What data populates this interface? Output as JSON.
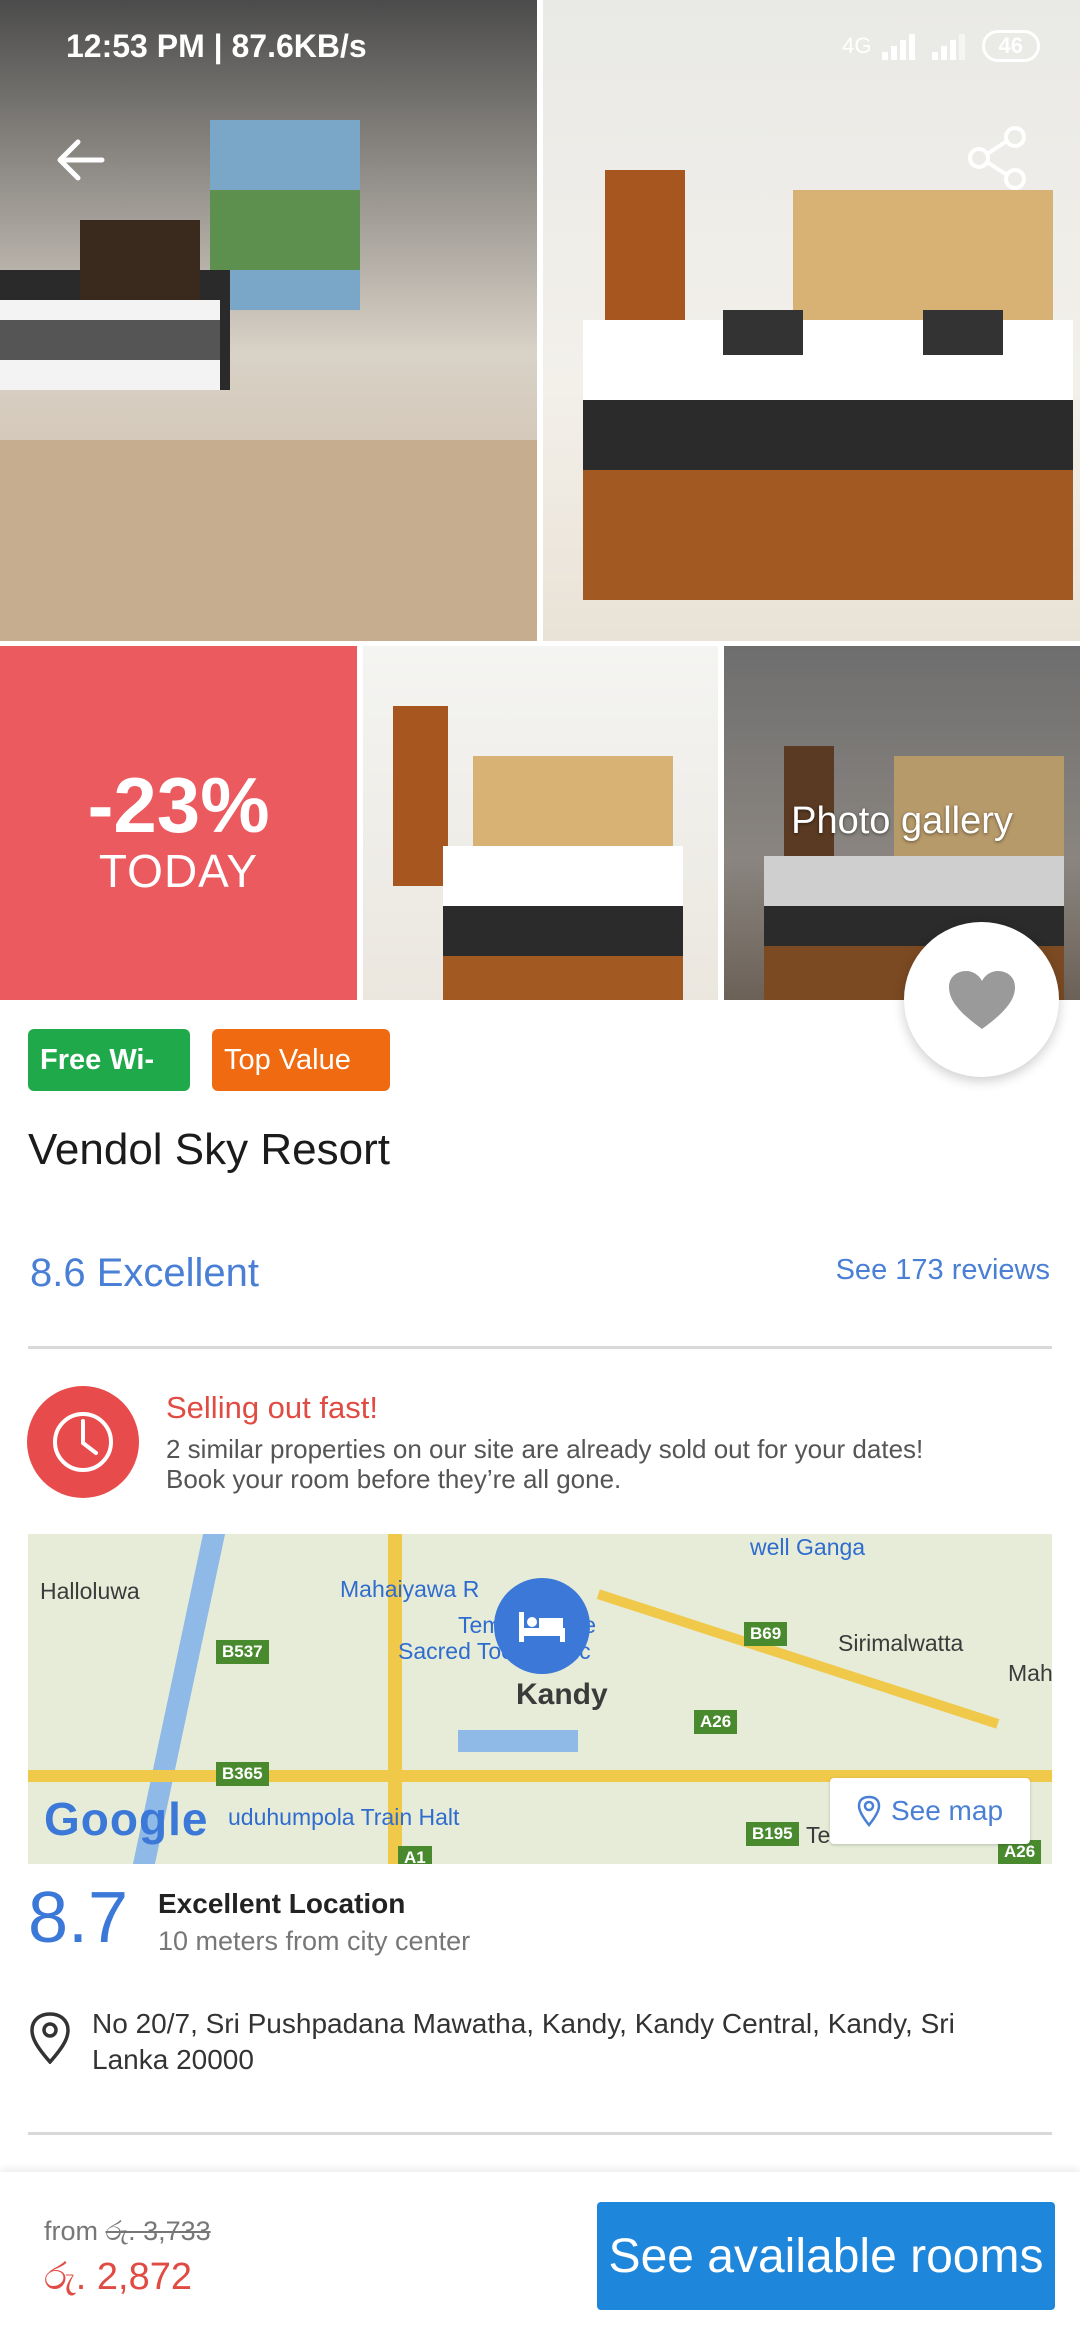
{
  "status_bar": {
    "time": "12:53 PM | 87.6KB/s",
    "network": "4G",
    "battery": "46"
  },
  "gallery": {
    "promo_discount": "-23%",
    "promo_period": "TODAY",
    "label": "Photo gallery"
  },
  "badges": {
    "wifi": "Free Wi-Fi",
    "top_value": "Top Value"
  },
  "hotel": {
    "name": "Vendol Sky Resort",
    "score": "8.6",
    "score_label": "Excellent",
    "reviews_link": "See 173 reviews"
  },
  "urgency": {
    "title": "Selling out fast!",
    "line1": "2 similar properties on our site are already sold out for your dates!",
    "line2": "Book your room before they’re all gone."
  },
  "map": {
    "labels": {
      "halloluwa": "Halloluwa",
      "mahaiyawa": "Mahaiyawa R",
      "temple1": "Temple of the",
      "temple2": "Sacred Tooth Relic",
      "sirimalwatta": "Sirimalwatta",
      "kandy": "Kandy",
      "train": "uduhumpola Train Halt",
      "mah": "Mah",
      "ganga": "well Ganga",
      "te": "Te"
    },
    "shields": {
      "b537": "B537",
      "b365": "B365",
      "b69": "B69",
      "a26a": "A26",
      "a26b": "A26",
      "b195": "B195",
      "a1": "A1"
    },
    "google_logo": "Google",
    "see_map": "See map"
  },
  "location": {
    "score": "8.7",
    "title": "Excellent Location",
    "subtitle": "10 meters from city center"
  },
  "address": {
    "line1": "No 20/7, Sri Pushpadana Mawatha, Kandy, Kandy Central, Kandy, Sri",
    "line2": "Lanka 20000"
  },
  "booking": {
    "from_label": "from",
    "original_price": "රු. 3,733",
    "price": "රු. 2,872",
    "cta": "See available rooms"
  },
  "colors": {
    "accent_blue": "#1e86db",
    "promo_red": "#ea5a5f",
    "wifi_green": "#20a94a",
    "top_value_orange": "#f06a12",
    "urgency_red": "#e04b43"
  }
}
